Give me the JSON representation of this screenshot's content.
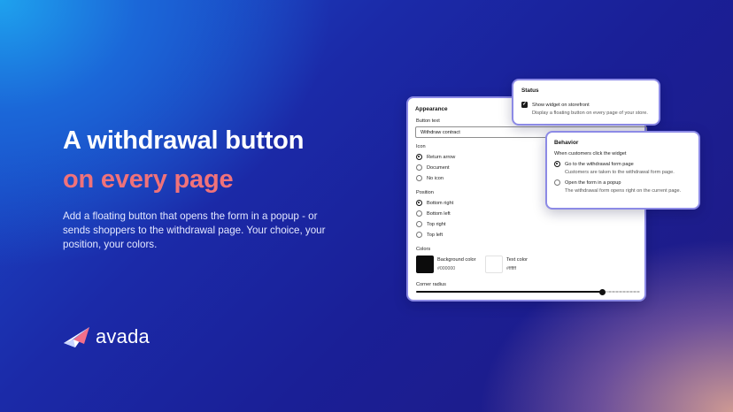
{
  "hero": {
    "headline_line1": "A withdrawal button",
    "headline_line2": "on every page",
    "body": "Add a floating button that opens the form in a popup - or sends shoppers to the withdrawal page. Your choice, your position, your colors.",
    "brand": "avada",
    "colors": {
      "accent": "#f0727a",
      "headline": "#ffffff"
    }
  },
  "appearance": {
    "title": "Appearance",
    "button_text_label": "Button text",
    "button_text_value": "Withdraw contract",
    "icon_label": "Icon",
    "icon_options": [
      {
        "label": "Return arrow",
        "selected": true
      },
      {
        "label": "Document",
        "selected": false
      },
      {
        "label": "No icon",
        "selected": false
      }
    ],
    "position_label": "Position",
    "position_options": [
      {
        "label": "Bottom right",
        "selected": true
      },
      {
        "label": "Bottom left",
        "selected": false
      },
      {
        "label": "Top right",
        "selected": false
      },
      {
        "label": "Top left",
        "selected": false
      }
    ],
    "colors_label": "Colors",
    "background_color_label": "Background color",
    "background_color_value": "#000000",
    "text_color_label": "Text color",
    "text_color_value": "#ffffff",
    "corner_radius_label": "Corner radius",
    "corner_radius_fraction": 0.83
  },
  "status": {
    "title": "Status",
    "show_widget_label": "Show widget on storefront",
    "show_widget_checked": true,
    "show_widget_help": "Display a floating button on every page of your store."
  },
  "behavior": {
    "title": "Behavior",
    "question": "When customers click the widget",
    "options": [
      {
        "label": "Go to the withdrawal form page",
        "help": "Customers are taken to the withdrawal form page.",
        "selected": true
      },
      {
        "label": "Open the form in a popup",
        "help": "The withdrawal form opens right on the current page.",
        "selected": false
      }
    ]
  }
}
